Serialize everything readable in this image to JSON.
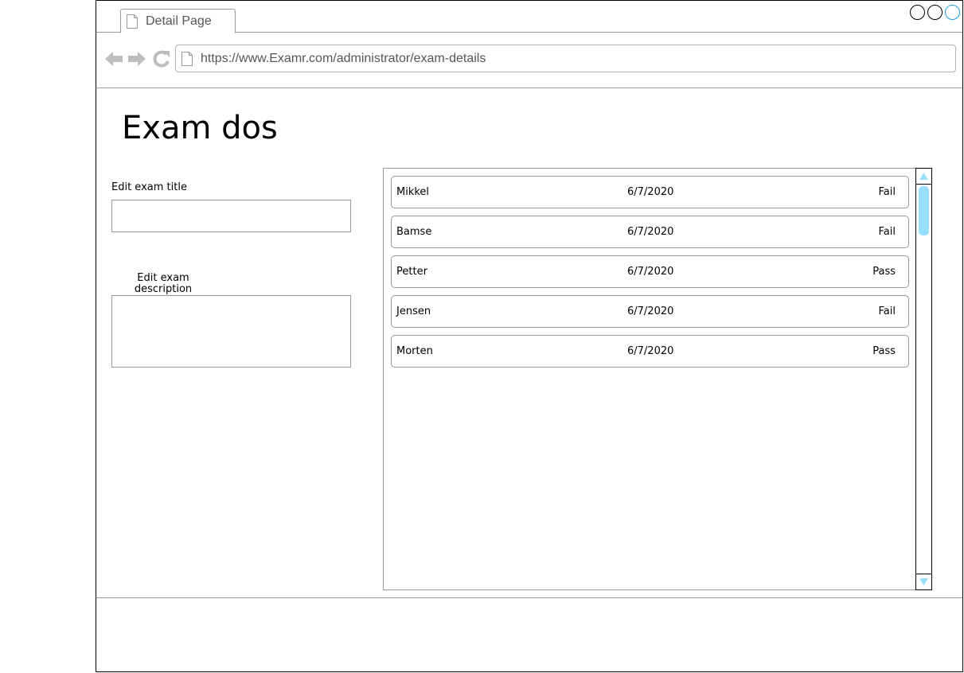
{
  "browser": {
    "tab_title": "Detail Page",
    "url": "https://www.Examr.com/administrator/exam-details",
    "icons": {
      "tab": "page-icon",
      "back": "back-arrow-icon",
      "forward": "forward-arrow-icon",
      "reload": "reload-icon",
      "url": "page-icon"
    },
    "accent_color": "#1ba1e2"
  },
  "page": {
    "title": "Exam dos",
    "edit_title_label": "Edit exam title",
    "edit_title_value": "",
    "edit_description_label": "Edit exam\ndescription",
    "edit_description_value": ""
  },
  "results": [
    {
      "name": "Mikkel",
      "date": "6/7/2020",
      "result": "Fail"
    },
    {
      "name": "Bamse",
      "date": "6/7/2020",
      "result": "Fail"
    },
    {
      "name": "Petter",
      "date": "6/7/2020",
      "result": "Pass"
    },
    {
      "name": "Jensen",
      "date": "6/7/2020",
      "result": "Fail"
    },
    {
      "name": "Morten",
      "date": "6/7/2020",
      "result": "Pass"
    }
  ],
  "scrollbar": {
    "thumb_color": "#99ddff"
  }
}
